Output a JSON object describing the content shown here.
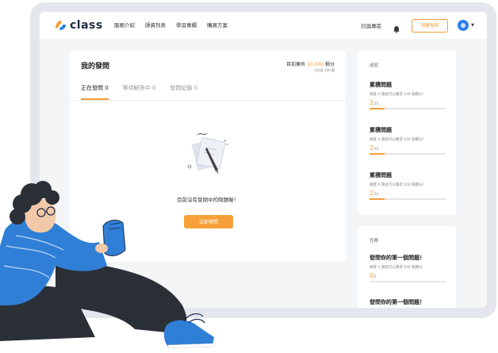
{
  "brand": {
    "name": "class",
    "accent": "#f39c38",
    "dark": "#1f2a44",
    "primary": "#2f80ed"
  },
  "nav": {
    "links": [
      "服務介紹",
      "師資列表",
      "學習專欄",
      "購買方案"
    ],
    "forum": "討論專區",
    "ask_button": "我要發問",
    "icons": {
      "bell": "bell-icon",
      "avatar": "avatar-icon",
      "caret": "chevron-down-icon"
    }
  },
  "main": {
    "title": "我的發問",
    "points_prefix": "目前擁有",
    "points_value": "10,000",
    "points_suffix": "積分",
    "points_sub": "可兌換 100 題",
    "tabs": [
      {
        "label": "正在發問",
        "count": "0"
      },
      {
        "label": "等待解答中",
        "count": "0"
      },
      {
        "label": "發問紀錄",
        "count": "0"
      }
    ],
    "active_tab": 0,
    "empty_text": "目前沒有發問中的問題喔！",
    "cta": "立即發問"
  },
  "achievements": {
    "title": "成就",
    "items": [
      {
        "title": "累積問題",
        "desc": "總產 6 題就可以獲得 100 點積分！",
        "current": "2",
        "total": "/10",
        "progress": 0.2
      },
      {
        "title": "累積問題",
        "desc": "總產 6 題就可以獲得 100 點積分！",
        "current": "2",
        "total": "/10",
        "progress": 0.2
      },
      {
        "title": "累積問題",
        "desc": "總產 6 題就可以獲得 100 點積分！",
        "current": "2",
        "total": "/10",
        "progress": 0.2
      }
    ]
  },
  "tasks": {
    "title": "任務",
    "items": [
      {
        "title": "發問你的第一個問題！",
        "desc": "總產 1 題就可以獲得 100 點積分",
        "current": "0",
        "total": "/1",
        "progress": 0
      },
      {
        "title": "發問你的第一個問題！"
      }
    ]
  }
}
